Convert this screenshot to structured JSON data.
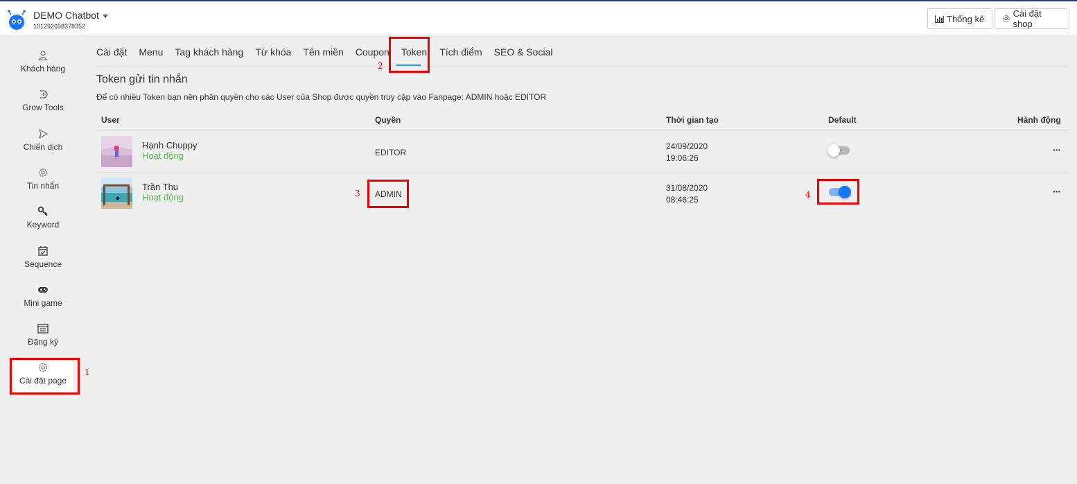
{
  "header": {
    "brand": "DEMO Chatbot",
    "shop_id": "101292658378352",
    "stats_button": "Thống kê",
    "shop_settings_button": "Cài đặt shop"
  },
  "sidebar": {
    "items": [
      {
        "label": "Khách hàng",
        "icon": "user-icon"
      },
      {
        "label": "Grow Tools",
        "icon": "grow-icon"
      },
      {
        "label": "Chiến dịch",
        "icon": "send-icon"
      },
      {
        "label": "Tin nhắn",
        "icon": "message-icon"
      },
      {
        "label": "Keyword",
        "icon": "key-icon"
      },
      {
        "label": "Sequence",
        "icon": "calendar-check-icon"
      },
      {
        "label": "Mini game",
        "icon": "gamepad-icon"
      },
      {
        "label": "Đăng ký",
        "icon": "form-icon"
      },
      {
        "label": "Cài đặt page",
        "icon": "gear-icon"
      }
    ]
  },
  "tabs": [
    "Cài đặt",
    "Menu",
    "Tag khách hàng",
    "Từ khóa",
    "Tên miền",
    "Coupon",
    "Token",
    "Tích điểm",
    "SEO & Social"
  ],
  "section": {
    "title": "Token gửi tin nhắn",
    "description": "Để có nhiều Token bạn nên phân quyền cho các User của Shop được quyền truy cập vào Fanpage: ADMIN hoặc EDITOR"
  },
  "table": {
    "headers": {
      "user": "User",
      "role": "Quyền",
      "created": "Thời gian tạo",
      "default": "Default",
      "actions": "Hành động"
    },
    "rows": [
      {
        "name": "Hạnh Chuppy",
        "status": "Hoạt động",
        "role": "EDITOR",
        "date": "24/09/2020",
        "time": "19:06:26",
        "default": false,
        "actions": "···"
      },
      {
        "name": "Trần Thu",
        "status": "Hoạt động",
        "role": "ADMIN",
        "date": "31/08/2020",
        "time": "08:46:25",
        "default": true,
        "actions": "···"
      }
    ]
  },
  "annotations": {
    "n1": "1",
    "n2": "2",
    "n3": "3",
    "n4": "4"
  },
  "colors": {
    "highlight": "#ee0000",
    "active_status": "#5cb85c",
    "toggle_on": "#1877f2",
    "tab_underline": "#1b9ad6"
  }
}
